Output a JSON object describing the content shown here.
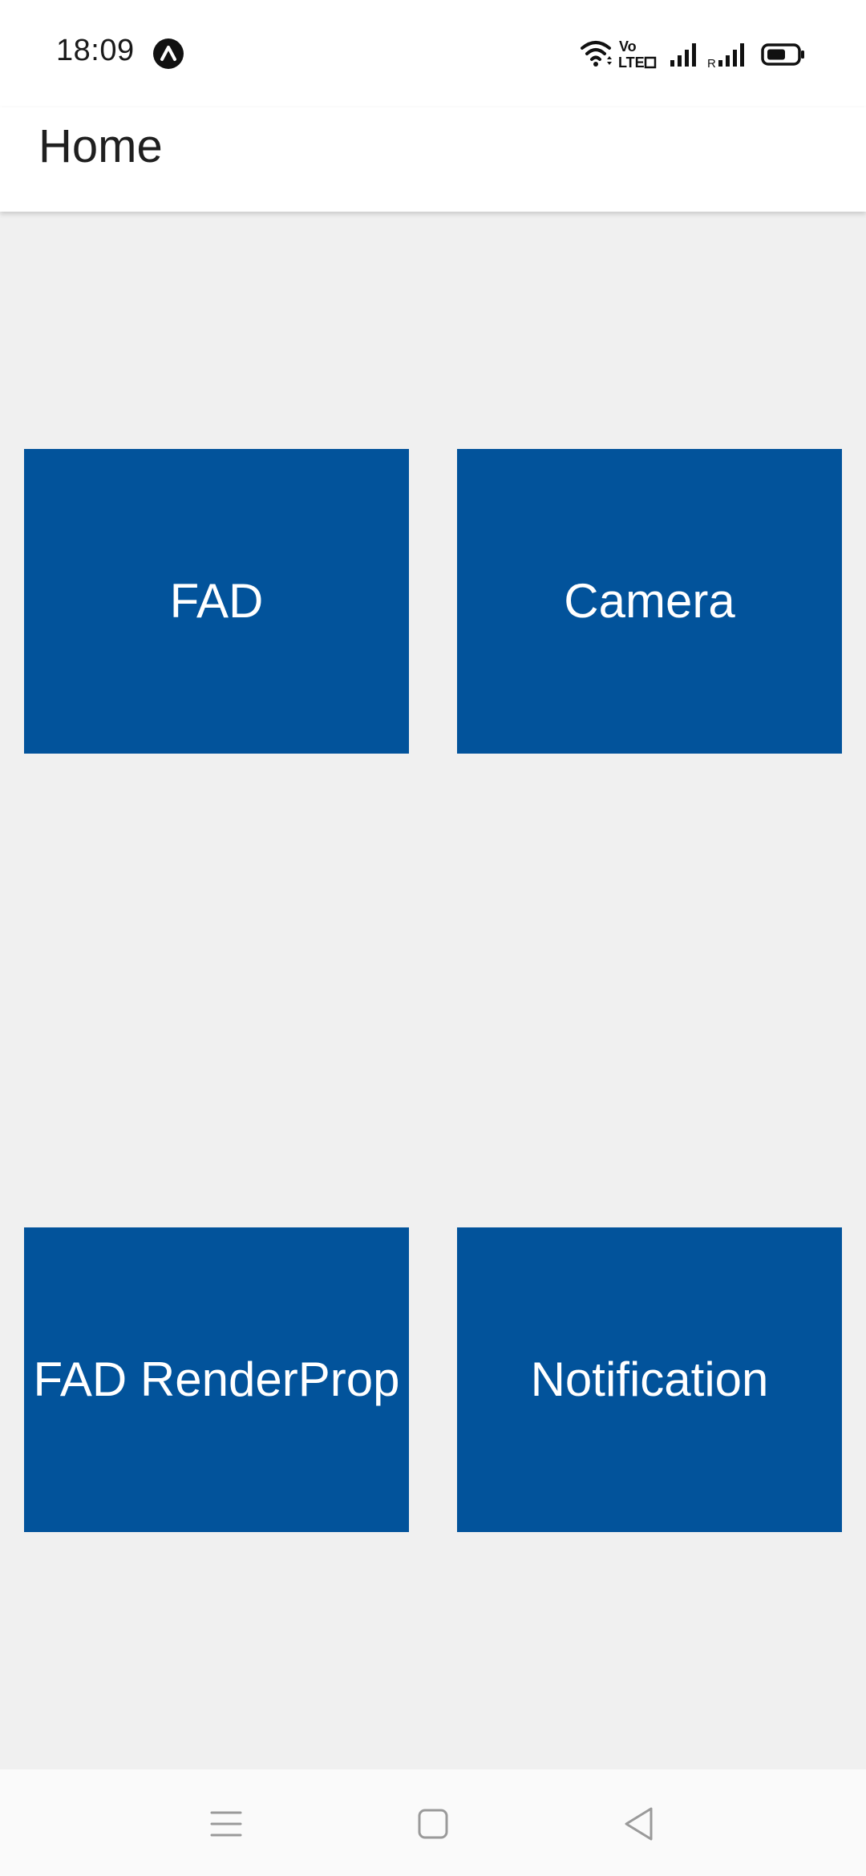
{
  "status_bar": {
    "time": "18:09",
    "app_icon": "expo-caret-icon",
    "icons": [
      "wifi-icon",
      "volte-icon",
      "signal-icon",
      "roaming-signal-icon",
      "battery-icon"
    ],
    "roaming_label": "R",
    "volte_label_top": "Vo",
    "volte_label_bottom": "LTE"
  },
  "app_bar": {
    "title": "Home"
  },
  "tiles": [
    {
      "label": "FAD"
    },
    {
      "label": "Camera"
    },
    {
      "label": "FAD RenderProp"
    },
    {
      "label": "Notification"
    }
  ],
  "nav_bar": {
    "icons": [
      "menu-icon",
      "home-icon",
      "back-icon"
    ]
  },
  "colors": {
    "tile_background": "#02539b",
    "tile_text": "#ffffff",
    "page_background": "#f0f0f0",
    "app_bar_background": "#ffffff"
  }
}
